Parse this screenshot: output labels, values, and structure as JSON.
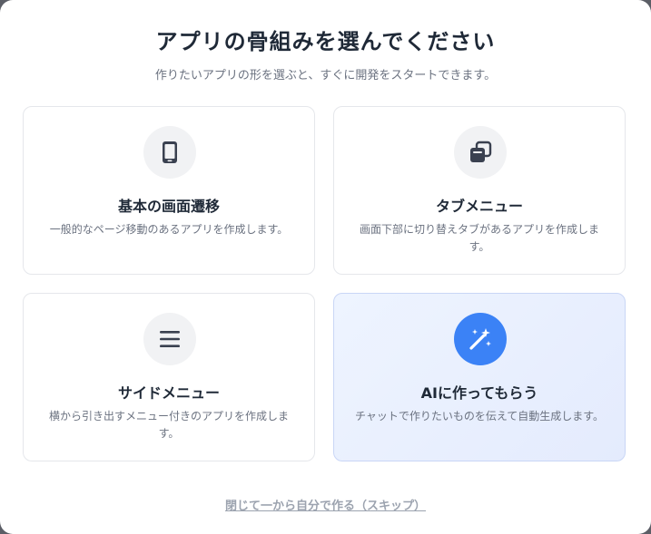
{
  "modal": {
    "title": "アプリの骨組みを選んでください",
    "subtitle": "作りたいアプリの形を選ぶと、すぐに開発をスタートできます。"
  },
  "options": [
    {
      "title": "基本の画面遷移",
      "description": "一般的なページ移動のあるアプリを作成します。",
      "icon": "smartphone-icon"
    },
    {
      "title": "タブメニュー",
      "description": "画面下部に切り替えタブがあるアプリを作成します。",
      "icon": "stacked-cards-icon"
    },
    {
      "title": "サイドメニュー",
      "description": "横から引き出すメニュー付きのアプリを作成します。",
      "icon": "hamburger-menu-icon"
    },
    {
      "title": "AIに作ってもらう",
      "description": "チャットで作りたいものを伝えて自動生成します。",
      "icon": "magic-wand-sparkles-icon"
    }
  ],
  "skip_link": "閉じて一から自分で作る（スキップ）",
  "colors": {
    "ai_accent": "#3b82f6",
    "ai_card_bg": "#eef4ff",
    "title_text": "#1f2937",
    "muted_text": "#6b7280"
  }
}
